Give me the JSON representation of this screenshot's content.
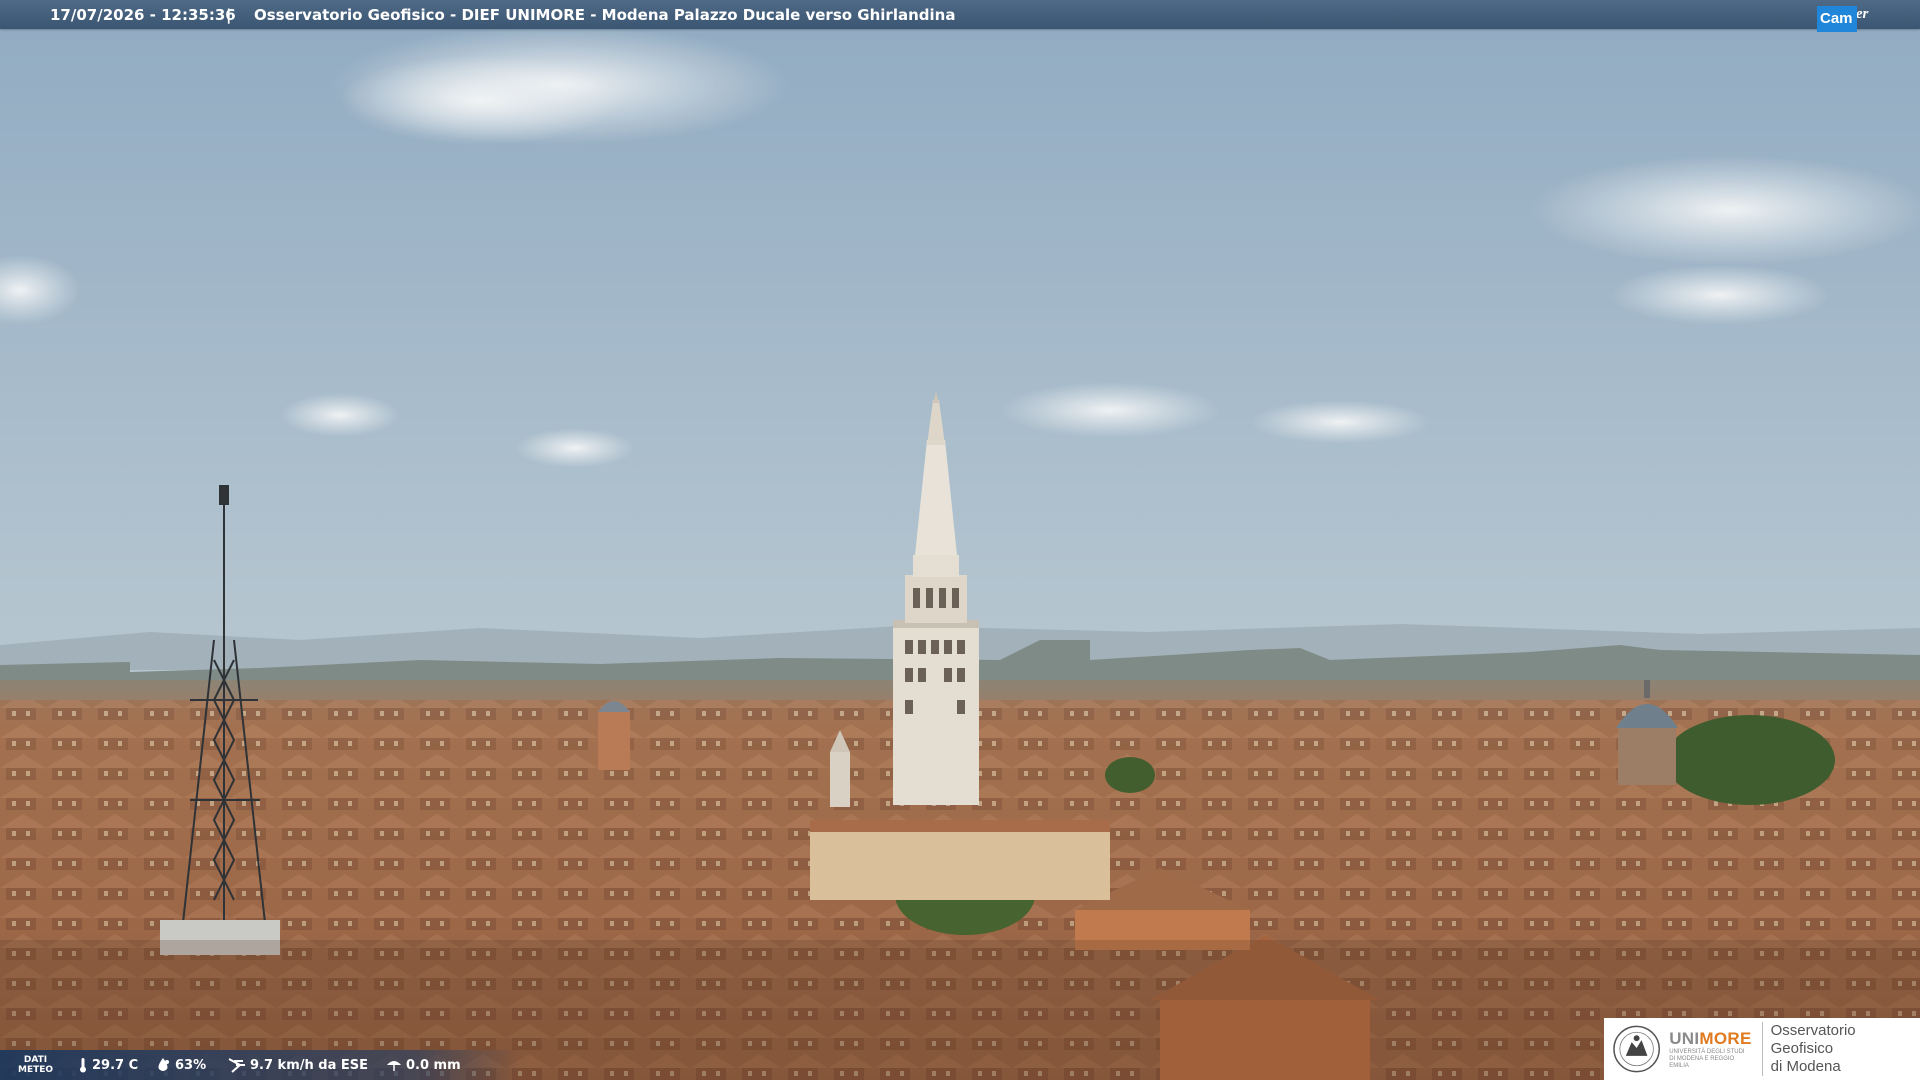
{
  "header": {
    "datetime": "17/07/2026 - 12:35:36",
    "separator": "|",
    "title": "Osservatorio Geofisico - DIEF UNIMORE - Modena Palazzo Ducale verso Ghirlandina",
    "brand_weather": "Weather",
    "brand_cam": "Cam"
  },
  "meteo": {
    "label_line1": "DATI",
    "label_line2": "METEO",
    "temperature": "29.7 C",
    "humidity": "63%",
    "wind": "9.7 km/h da ESE",
    "rain": "0.0 mm",
    "icons": [
      "thermometer-icon",
      "humidity-drop-icon",
      "wind-icon",
      "rain-icon"
    ]
  },
  "logo": {
    "uni_prefix": "UNI",
    "uni_suffix": "MORE",
    "uni_sub": "UNIVERSITÀ DEGLI STUDI DI MODENA E REGGIO EMILIA",
    "observatory_line1": "Osservatorio Geofisico",
    "observatory_line2": "di Modena"
  },
  "colors": {
    "bar": "#3b5672",
    "brand_accent": "#1f86d9",
    "uni_accent": "#e07a1f",
    "sky": "#a7bccb",
    "roofs": "#b07a55"
  }
}
